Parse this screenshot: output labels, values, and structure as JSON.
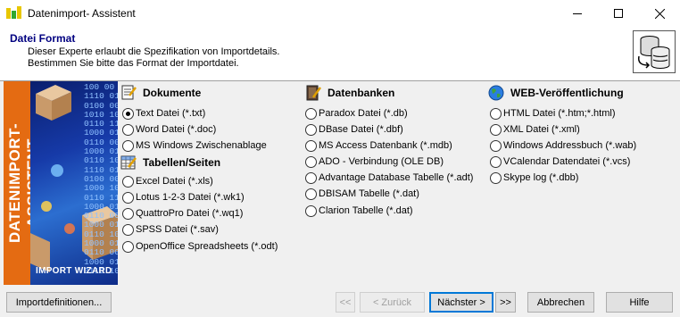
{
  "window": {
    "title": "Datenimport- Assistent"
  },
  "header": {
    "title": "Datei Format",
    "description_line1": "Dieser Experte erlaubt die Spezifikation von Importdetails.",
    "description_line2": "Bestimmen Sie bitte das Format der Importdatei."
  },
  "banner": {
    "vertical_text": "DATENIMPORT-ASSISTENT",
    "bottom_text": "IMPORT WIZARD",
    "digits": "100 00\n1110 01\n0100 00\n1010 10\n0110 11\n1000 01\n0110 00\n1000 01\n0110 10\n1110 01\n0100 00\n1000 10\n0110 11\n1000 01\n0110 00\n1000 01\n0110 10\n1000 01\n0110 00\n1000 01\n0110 10"
  },
  "sections": {
    "dokumente": {
      "label": "Dokumente",
      "items": [
        "Text Datei (*.txt)",
        "Word Datei (*.doc)",
        "MS Windows Zwischenablage"
      ]
    },
    "tabellen": {
      "label": "Tabellen/Seiten",
      "items": [
        "Excel Datei (*.xls)",
        "Lotus 1-2-3 Datei (*.wk1)",
        "QuattroPro Datei (*.wq1)",
        "SPSS Datei (*.sav)",
        "OpenOffice Spreadsheets (*.odt)"
      ]
    },
    "datenbanken": {
      "label": "Datenbanken",
      "items": [
        "Paradox Datei (*.db)",
        "DBase Datei (*.dbf)",
        "MS Access Datenbank (*.mdb)",
        "ADO - Verbindung (OLE DB)",
        "Advantage Database Tabelle (*.adt)",
        "DBISAM Tabelle (*.dat)",
        "Clarion Tabelle (*.dat)"
      ]
    },
    "web": {
      "label": "WEB-Veröffentlichung",
      "items": [
        "HTML Datei (*.htm;*.html)",
        "XML Datei (*.xml)",
        "Windows Addressbuch (*.wab)",
        "VCalendar Datendatei (*.vcs)",
        "Skype log (*.dbb)"
      ]
    }
  },
  "selected_format": "Text Datei (*.txt)",
  "buttons": {
    "import_definitions": "Importdefinitionen...",
    "first": "<<",
    "back": "< Zurück",
    "next": "Nächster >",
    "last": ">>",
    "cancel": "Abbrechen",
    "help": "Hilfe"
  }
}
